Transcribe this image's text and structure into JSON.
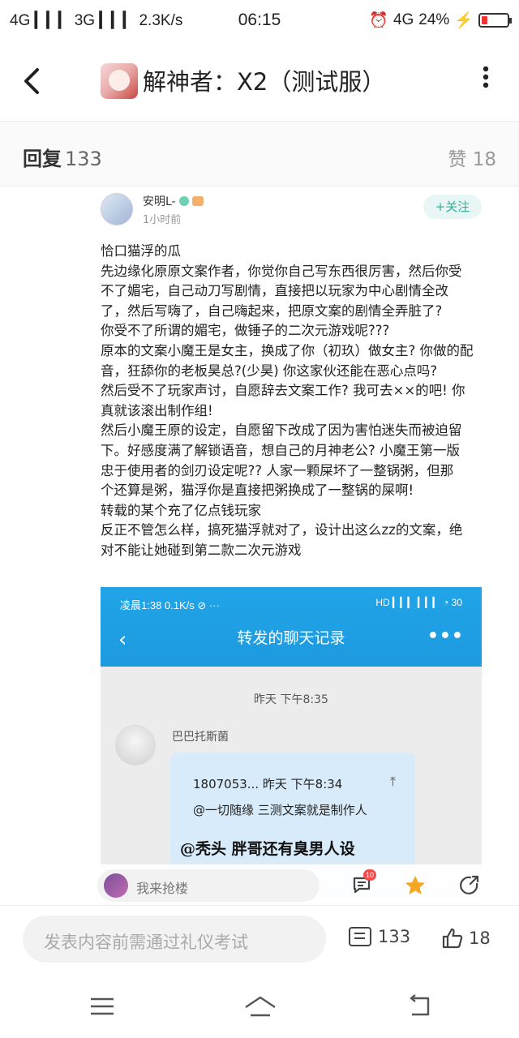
{
  "status_bar": {
    "left": "4G ▎▎▎ 3G ▎▎▎ 2.3K/s",
    "time": "06:15",
    "network": "4G",
    "battery": "24%",
    "battery_level": 0.24
  },
  "header": {
    "back_icon": "chevron-left-icon",
    "title": "解神者：X2（测试服）",
    "more_icon": "more-vertical-icon"
  },
  "reply_bar": {
    "reply_label": "回复",
    "reply_count": "133",
    "like_label": "赞",
    "like_count": "18"
  },
  "post": {
    "username": "安明L-",
    "time": "1小时前",
    "follow_label": "+关注",
    "lines": [
      "恰口猫浮的瓜",
      "先边缘化原原文案作者，你觉你自己写东西很厉害，然后你受",
      "不了媚宅，自己动刀写剧情，直接把以玩家为中心剧情全改",
      "了，然后写嗨了，自己嗨起来，把原文案的剧情全弄脏了?",
      "你受不了所谓的媚宅，做锤子的二次元游戏呢???",
      "原本的文案小魔王是女主，换成了你（初玖）做女主? 你做的配",
      "音，狂舔你的老板昊总?(少昊) 你这家伙还能在恶心点吗?",
      "然后受不了玩家声讨，自愿辞去文案工作? 我可去××的吧! 你",
      "真就该滚出制作组!",
      "然后小魔王原的设定，自愿留下改成了因为害怕迷失而被迫留",
      "下。好感度满了解锁语音，想自己的月神老公? 小魔王第一版",
      "忠于使用者的剑刃设定呢?? 人家一颗屎坏了一整锅粥，但那",
      "个还算是粥，猫浮你是直接把粥换成了一整锅的屎啊!",
      "转载的某个充了亿点钱玩家",
      "反正不管怎么样，搞死猫浮就对了，设计出这么zz的文案，绝",
      "对不能让她碰到第二款二次元游戏"
    ],
    "embedded_screenshot": {
      "status_left": "凌晨1:38 0.1K/s ⊘ ···",
      "status_right": "HD ▎▎▎ ▎▎▎ ◔ 30",
      "title": "转发的聊天记录",
      "time_divider": "昨天 下午8:35",
      "sender": "巴巴托斯菌",
      "bubble_line1": "1807053... 昨天 下午8:34",
      "bubble_line2": "@一切随缘 三测文案就是制作人",
      "bubble_line3": "@秃头 胖哥还有臭男人设"
    }
  },
  "float_bar": {
    "grab_placeholder": "我来抢楼",
    "notif_count": "10"
  },
  "comment_bar": {
    "placeholder": "发表内容前需通过礼仪考试",
    "comment_count": "133",
    "like_count": "18"
  },
  "colors": {
    "accent_teal": "#2bb39a",
    "chat_header_blue": "#1e9ae0",
    "badge_red": "#f24b4b",
    "star_orange": "#f5a623"
  }
}
